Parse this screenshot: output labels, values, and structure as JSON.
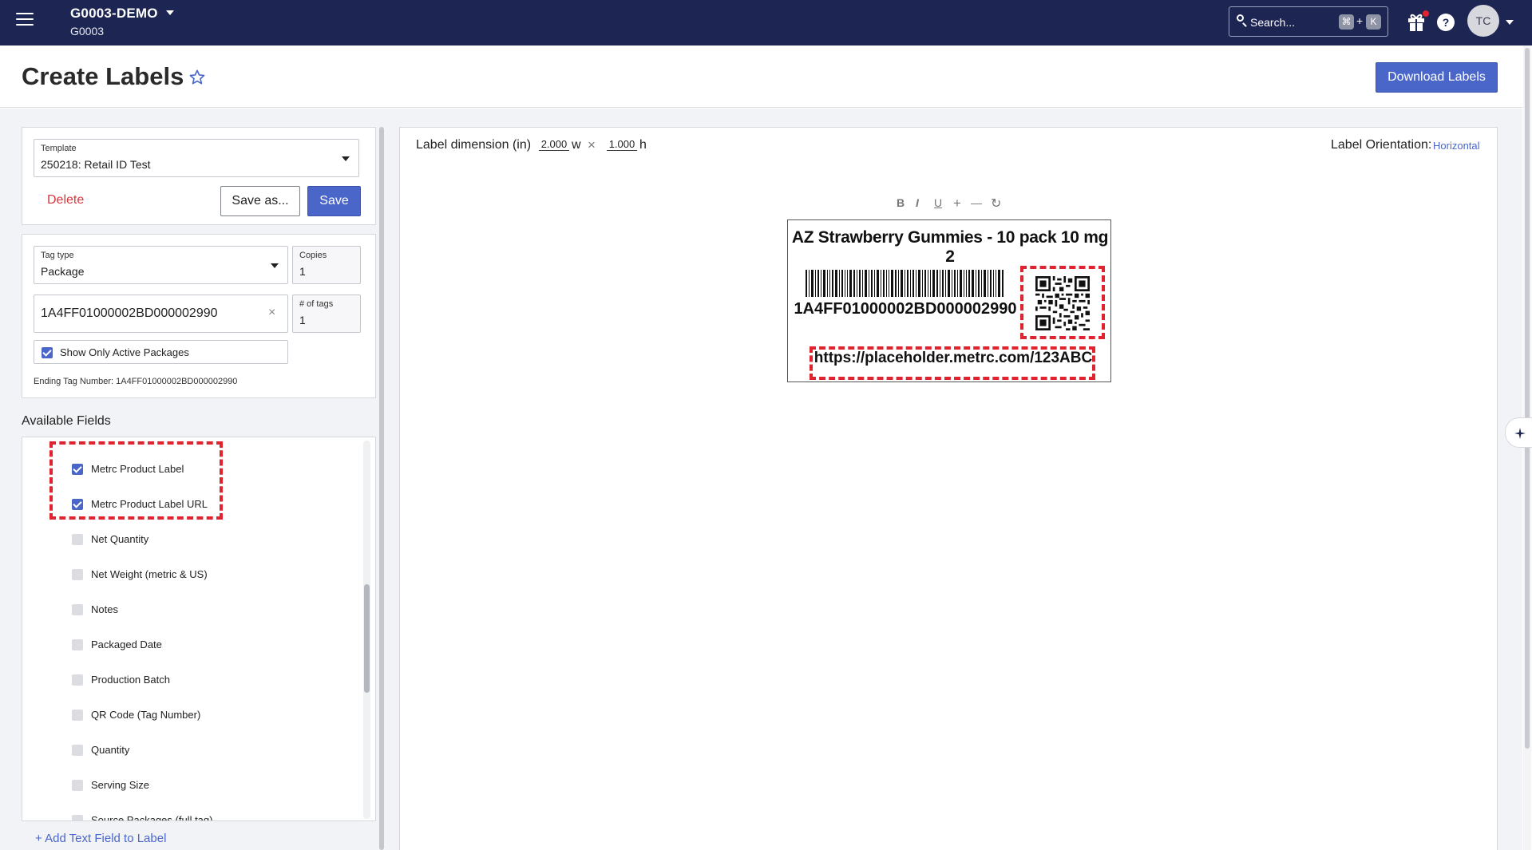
{
  "topbar": {
    "org_name": "G0003-DEMO",
    "org_code": "G0003",
    "search_placeholder": "Search...",
    "shortcut_cmd": "⌘",
    "shortcut_plus": "+",
    "shortcut_key": "K",
    "help_label": "?",
    "avatar_initials": "TC"
  },
  "header": {
    "title": "Create Labels",
    "download_label": "Download Labels"
  },
  "template_section": {
    "label": "Template",
    "value": "250218: Retail ID Test",
    "delete_label": "Delete",
    "save_as_label": "Save as...",
    "save_label": "Save"
  },
  "tag_section": {
    "tag_type_label": "Tag type",
    "tag_type_value": "Package",
    "copies_label": "Copies",
    "copies_value": "1",
    "tag_number_value": "1A4FF01000002BD000002990",
    "num_tags_label": "# of tags",
    "num_tags_value": "1",
    "show_active_label": "Show Only Active Packages",
    "show_active_checked": true,
    "ending_tag_text": "Ending Tag Number: 1A4FF01000002BD000002990"
  },
  "available_fields": {
    "heading": "Available Fields",
    "items": [
      {
        "label": "Metrc Product Label",
        "checked": true
      },
      {
        "label": "Metrc Product Label URL",
        "checked": true
      },
      {
        "label": "Net Quantity",
        "checked": false
      },
      {
        "label": "Net Weight (metric & US)",
        "checked": false
      },
      {
        "label": "Notes",
        "checked": false
      },
      {
        "label": "Packaged Date",
        "checked": false
      },
      {
        "label": "Production Batch",
        "checked": false
      },
      {
        "label": "QR Code (Tag Number)",
        "checked": false
      },
      {
        "label": "Quantity",
        "checked": false
      },
      {
        "label": "Serving Size",
        "checked": false
      },
      {
        "label": "Source Packages (full tag)",
        "checked": false
      }
    ],
    "add_text_field_label": "+ Add Text Field to Label"
  },
  "canvas": {
    "dimension_label": "Label dimension (in)",
    "width_value": "2.000",
    "width_unit": "w",
    "times": "×",
    "height_value": "1.000",
    "height_unit": "h",
    "orientation_label": "Label Orientation:",
    "orientation_value": "Horizontal",
    "toolbar": [
      "B",
      "I",
      "U",
      "+",
      "—",
      "↻"
    ]
  },
  "label_preview": {
    "product_name": "AZ Strawberry Gummies - 10 pack 10 mg 2",
    "barcode_text": "1A4FF01000002BD000002990",
    "url_text": "https://placeholder.metrc.com/123ABC"
  },
  "colors": {
    "topbar": "#1d2552",
    "accent": "#4a66c9",
    "danger": "#d9363e",
    "highlight_dash": "#e0242f"
  }
}
